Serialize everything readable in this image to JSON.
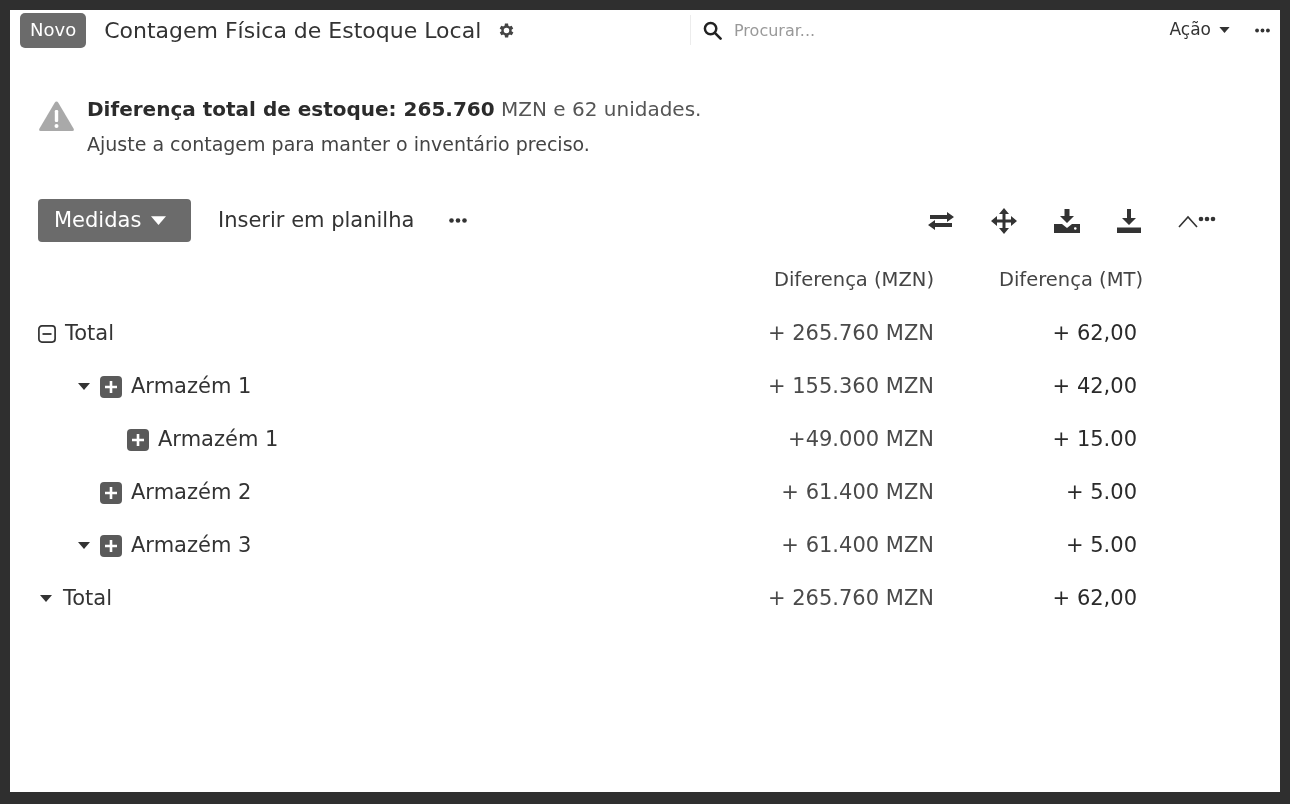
{
  "header": {
    "badge": "Novo",
    "title": "Contagem Física de Estoque Local",
    "search": {
      "placeholder": "Procurar..."
    },
    "action_menu": "Ação"
  },
  "alert": {
    "summary": "**Diferença total de estoque: 265.760** MZN e 62 unidades.",
    "hint": "Ajuste a contagem para manter o inventário preciso."
  },
  "toolbar": {
    "measures_button": "Medidas",
    "insert_button": "Inserir em planilha"
  },
  "table": {
    "columns": [
      "Diferença (MZN)",
      "Diferença (MT)"
    ],
    "rows": [
      {
        "label": "Total",
        "caret": false,
        "expanded": true,
        "values": [
          "+ 265.760 MZN",
          "+ 62,00"
        ],
        "children": [
          {
            "label": "Armazém 1",
            "caret": true,
            "expanded": false,
            "values": [
              "+ 155.360 MZN",
              "+ 42,00"
            ],
            "children": [
              {
                "label": "Armazém 1",
                "caret": false,
                "expanded": false,
                "values": [
                  "+49.000 MZN",
                  "+ 15.00"
                ]
              }
            ]
          },
          {
            "label": "Armazém 2",
            "caret": false,
            "expanded": false,
            "values": [
              "+ 61.400 MZN",
              "+ 5.00"
            ]
          },
          {
            "label": "Armazém 3",
            "caret": true,
            "expanded": false,
            "values": [
              "+ 61.400 MZN",
              "+ 5.00"
            ]
          }
        ]
      }
    ],
    "footer": {
      "label": "Total",
      "caret": true,
      "values": [
        "+ 265.760 MZN",
        "+ 62,00"
      ]
    }
  }
}
